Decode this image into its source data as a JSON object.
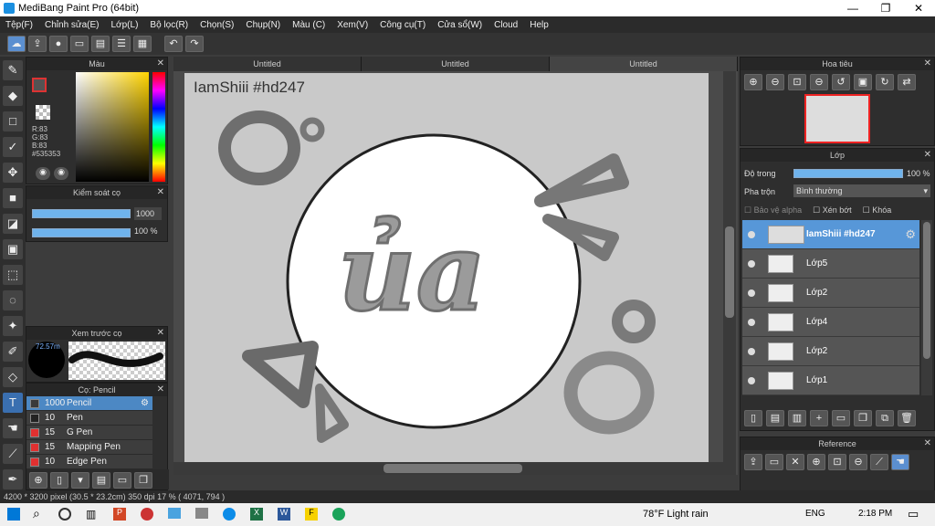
{
  "window": {
    "title": "MediBang Paint Pro (64bit)",
    "min": "—",
    "max": "❐",
    "close": "✕"
  },
  "menu": [
    "Tệp(F)",
    "Chỉnh sửa(E)",
    "Lớp(L)",
    "Bộ lọc(R)",
    "Chọn(S)",
    "Chụp(N)",
    "Màu (C)",
    "Xem(V)",
    "Công cụ(T)",
    "Cửa sổ(W)",
    "Cloud",
    "Help"
  ],
  "color_panel": {
    "title": "Màu",
    "r": "R:83",
    "g": "G:83",
    "b": "B:83",
    "hex": "#535353"
  },
  "brush_control": {
    "title": "Kiểm soát cọ",
    "size": "1000",
    "opacity": "100 %"
  },
  "brush_preview": {
    "title": "Xem trước cọ",
    "size_label": "72.57m"
  },
  "brush_list": {
    "title": "Cọ: Pencil",
    "items": [
      {
        "size": "1000",
        "name": "Pencil",
        "selected": true,
        "color": "#3a3a3a"
      },
      {
        "size": "10",
        "name": "Pen",
        "selected": false,
        "color": "#222222"
      },
      {
        "size": "15",
        "name": "G Pen",
        "selected": false,
        "color": "#e03030"
      },
      {
        "size": "15",
        "name": "Mapping Pen",
        "selected": false,
        "color": "#e03030"
      },
      {
        "size": "10",
        "name": "Edge Pen",
        "selected": false,
        "color": "#e03030"
      }
    ]
  },
  "tabs": [
    "Untitled",
    "Untitled",
    "Untitled"
  ],
  "canvas": {
    "watermark": "IamShiii #hd247",
    "art_text": "ủa"
  },
  "navigator": {
    "title": "Hoa tiêu"
  },
  "layers": {
    "title": "Lớp",
    "opacity_label": "Độ trong",
    "opacity_value": "100 %",
    "blend_label": "Pha trộn",
    "blend_value": "Bình thường",
    "protect_alpha": "Bảo vệ alpha",
    "clip": "Xén bớt",
    "lock": "Khóa",
    "items": [
      {
        "name": "IamShiii #hd247",
        "selected": true
      },
      {
        "name": "Lớp5",
        "selected": false
      },
      {
        "name": "Lớp2",
        "selected": false
      },
      {
        "name": "Lớp4",
        "selected": false
      },
      {
        "name": "Lớp2",
        "selected": false
      },
      {
        "name": "Lớp1",
        "selected": false
      }
    ]
  },
  "reference": {
    "title": "Reference"
  },
  "status": "4200 * 3200 pixel  (30.5 * 23.2cm)   350 dpi   17 %   ( 4071, 794 )",
  "taskbar": {
    "weather": "78°F  Light rain",
    "lang": "ENG",
    "time": "2:18 PM"
  }
}
